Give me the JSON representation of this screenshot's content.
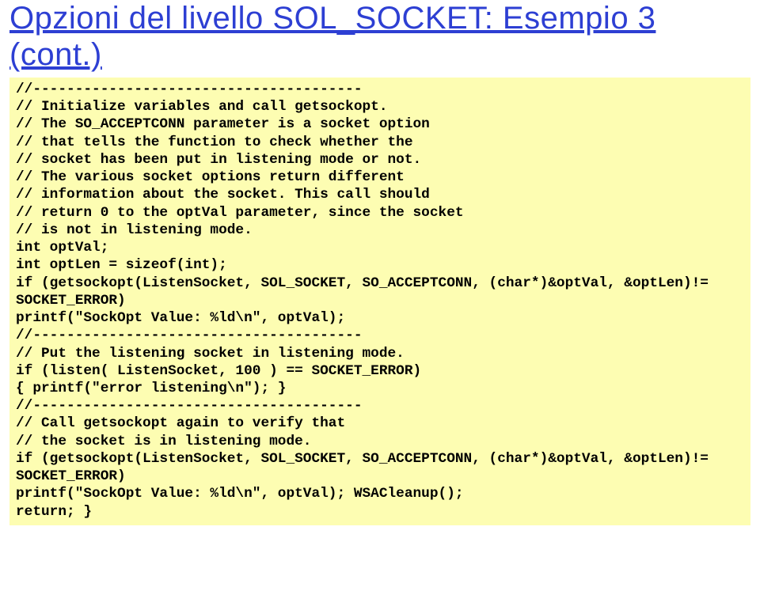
{
  "title": "Opzioni del livello SOL_SOCKET: Esempio 3 (cont.)",
  "code": "//---------------------------------------\n// Initialize variables and call getsockopt.\n// The SO_ACCEPTCONN parameter is a socket option\n// that tells the function to check whether the\n// socket has been put in listening mode or not.\n// The various socket options return different\n// information about the socket. This call should\n// return 0 to the optVal parameter, since the socket\n// is not in listening mode.\nint optVal;\nint optLen = sizeof(int);\nif (getsockopt(ListenSocket, SOL_SOCKET, SO_ACCEPTCONN, (char*)&optVal, &optLen)!= SOCKET_ERROR)\nprintf(\"SockOpt Value: %ld\\n\", optVal);\n//---------------------------------------\n// Put the listening socket in listening mode.\nif (listen( ListenSocket, 100 ) == SOCKET_ERROR)\n{ printf(\"error listening\\n\"); }\n//---------------------------------------\n// Call getsockopt again to verify that\n// the socket is in listening mode.\nif (getsockopt(ListenSocket, SOL_SOCKET, SO_ACCEPTCONN, (char*)&optVal, &optLen)!= SOCKET_ERROR)\nprintf(\"SockOpt Value: %ld\\n\", optVal); WSACleanup();\nreturn; }"
}
